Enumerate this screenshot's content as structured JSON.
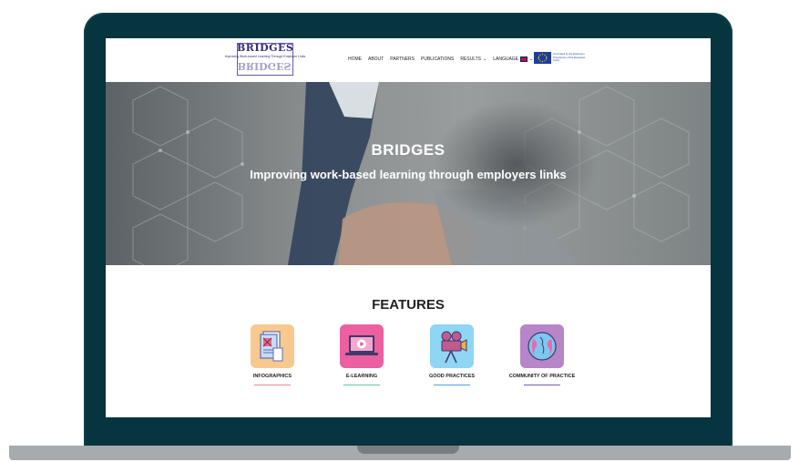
{
  "site": {
    "logo_word": "BRIDGES",
    "logo_tagline": "Improving Work-based Learning Through Employer Links",
    "nav": [
      {
        "label": "HOME"
      },
      {
        "label": "ABOUT"
      },
      {
        "label": "PARTNERS"
      },
      {
        "label": "PUBLICATIONS"
      },
      {
        "label": "RESULTS"
      },
      {
        "label": "LANGUAGE"
      }
    ],
    "eu_text": "Co-funded by the Erasmus+ Programme of the European Union"
  },
  "hero": {
    "title": "BRIDGES",
    "subtitle": "Improving work-based learning through employers links"
  },
  "features": {
    "title": "FEATURES",
    "items": [
      {
        "label": "INFOGRAPHICS",
        "icon": "infographics-icon",
        "bg": "#f7c98f",
        "line": "#e88b8b"
      },
      {
        "label": "E-LEARNING",
        "icon": "laptop-video-icon",
        "bg": "#ec5fa0",
        "line": "#5fc8a8"
      },
      {
        "label": "GOOD PRACTICES",
        "icon": "camera-icon",
        "bg": "#8ed6f4",
        "line": "#4aa8e0"
      },
      {
        "label": "COMMUNITY OF PRACTICE",
        "icon": "globe-heads-icon",
        "bg": "#b686c8",
        "line": "#7a5ab8"
      }
    ]
  },
  "colors": {
    "laptop_frame": "#06343f",
    "laptop_base": "#a7aaae",
    "logo_purple": "#3a2a7a",
    "eu_blue": "#1d3f9a"
  }
}
